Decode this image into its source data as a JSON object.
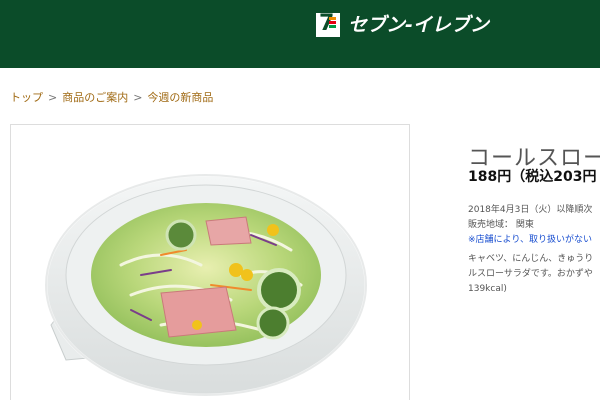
{
  "header": {
    "brand_name": "セブン-イレブン",
    "logo_mark": "7",
    "colors": {
      "bg": "#0b4c29",
      "stripe_orange": "#f08a00",
      "stripe_red": "#e60012",
      "stripe_green": "#009944"
    }
  },
  "breadcrumb": {
    "items": [
      "トップ",
      "商品のご案内",
      "今週の新商品"
    ],
    "separator": ">"
  },
  "product": {
    "image_icon": "salad-bowl-photo",
    "title": "コールスローサ",
    "price": "188円（税込203円",
    "release_date": "2018年4月3日（火）以降順次",
    "region_label": "販売地域：",
    "region_value": "関東",
    "notice": "※店舗により、取り扱いがない",
    "description": [
      "キャベツ、にんじん、きゅうり",
      "ルスローサラダです。おかずや",
      "139kcal)"
    ]
  }
}
